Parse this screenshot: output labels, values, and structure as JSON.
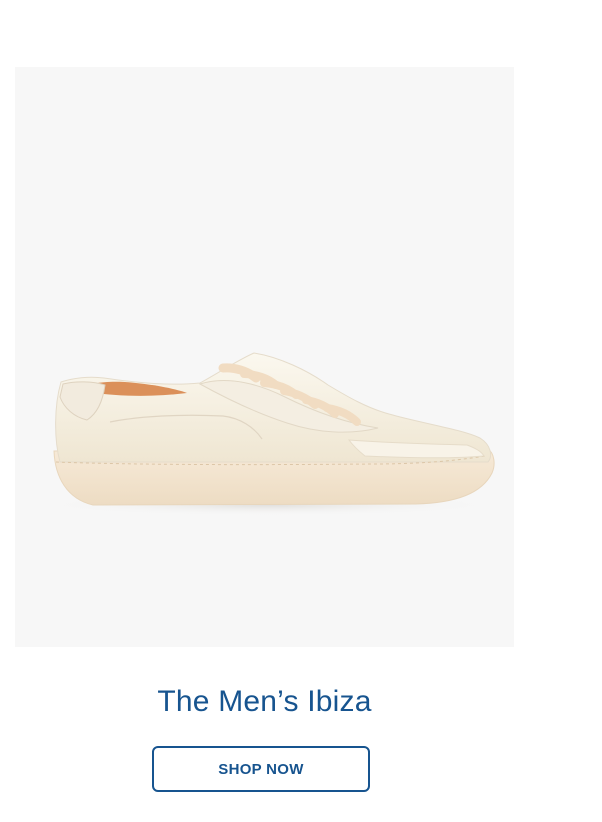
{
  "product": {
    "title": "The Men’s Ibiza",
    "button_label": "SHOP NOW",
    "image_icon": "sneaker-image",
    "colors": {
      "title": "#17548f",
      "button_border": "#17548f",
      "image_background": "#f7f7f7",
      "sneaker_upper": "#f6f1e5",
      "sneaker_sole": "#f4e5cf"
    }
  }
}
